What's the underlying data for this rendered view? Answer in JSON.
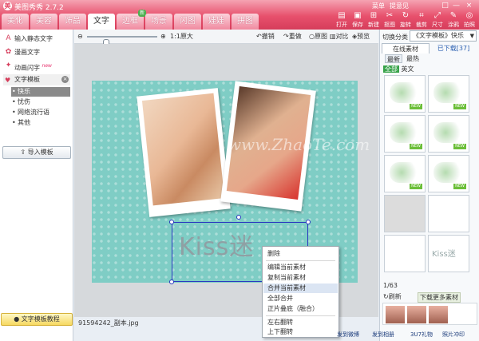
{
  "app": {
    "title": "美图秀秀 2.7.2",
    "logo_glyph": "美",
    "menu_label": "菜单",
    "feedback_label": "提意见"
  },
  "window_controls": [
    "□",
    "—",
    "×"
  ],
  "main_tabs": [
    {
      "label": "美化"
    },
    {
      "label": "美容"
    },
    {
      "label": "饰品"
    },
    {
      "label": "文字",
      "active": true
    },
    {
      "label": "边框",
      "badge": "新"
    },
    {
      "label": "场景"
    },
    {
      "label": "闪图"
    },
    {
      "label": "娃娃"
    },
    {
      "label": "拼图"
    }
  ],
  "tools": [
    {
      "icon": "▤",
      "label": "打开"
    },
    {
      "icon": "▣",
      "label": "保存"
    },
    {
      "icon": "⊞",
      "label": "新建"
    },
    {
      "icon": "✂",
      "label": "抠图"
    },
    {
      "icon": "↻",
      "label": "旋转"
    },
    {
      "icon": "⌗",
      "label": "裁剪"
    },
    {
      "icon": "⤢",
      "label": "尺寸"
    },
    {
      "icon": "✎",
      "label": "涂鸦"
    },
    {
      "icon": "◎",
      "label": "拍照"
    }
  ],
  "left_panel": {
    "items": [
      {
        "label": "输入静态文字",
        "icon": "A"
      },
      {
        "label": "漫画文字",
        "icon": "✿"
      },
      {
        "label": "动画闪字",
        "icon": "✦",
        "new": "new"
      }
    ],
    "section": {
      "label": "文字模板",
      "icon": "♥",
      "close": "×"
    },
    "sub_items": [
      {
        "label": "快乐",
        "active": true
      },
      {
        "label": "忧伤"
      },
      {
        "label": "网络流行语"
      },
      {
        "label": "其他"
      }
    ],
    "import_label": "导入模板",
    "tutorial_label": "文字模板教程"
  },
  "canvas_toolbar": {
    "zoom_label": "1:1原大",
    "undo": "撤销",
    "redo": "重做",
    "original": "原图",
    "compare": "对比",
    "preview": "预览"
  },
  "canvas": {
    "watermark": "www.ZhaoTe.com",
    "text_material": "Kiss迷",
    "filename": "91594242_副本.jpg"
  },
  "context_menu": {
    "items": [
      "删除",
      "编辑当前素材",
      "复制当前素材",
      "合并当前素材",
      "全部合并",
      "正片叠底（融合）",
      "左右翻转",
      "上下翻转"
    ],
    "hover_index": 3
  },
  "right_panel": {
    "switch_label": "切换分类",
    "category_value": "《文字模板》快乐",
    "tabs": [
      "在线素材",
      "已下载[37]"
    ],
    "sub_tabs": [
      "最新",
      "最热"
    ],
    "filter": {
      "all": "全部",
      "other": "英文"
    },
    "new_badge": "NEW",
    "thumb_captions": [
      "Kiss迷"
    ],
    "pager": "1/63",
    "refresh": "刷新",
    "more": "下载更多素材"
  },
  "status_bar": {
    "weibo": "发到微博",
    "album": "发到相册",
    "share": "3U7礼物",
    "print": "照片冲印"
  },
  "colors": {
    "accent": "#e7506c",
    "selection": "#2a38c0",
    "canvas_bg": "#7fcdc5"
  }
}
